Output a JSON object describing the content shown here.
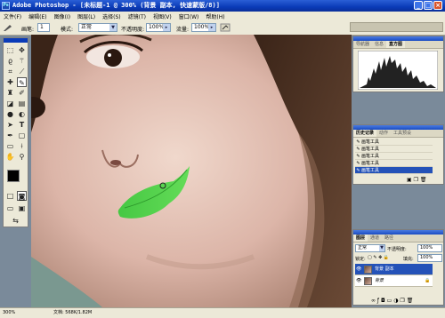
{
  "window": {
    "title": "Adobe Photoshop - [未标题-1 @ 300% (背景 副本, 快速蒙版/8)]",
    "app_icon": "Ps"
  },
  "window_controls": {
    "minimize": "_",
    "maximize": "□",
    "close": "×"
  },
  "menu": [
    "文件(F)",
    "编辑(E)",
    "图像(I)",
    "图层(L)",
    "选择(S)",
    "滤镜(T)",
    "视图(V)",
    "窗口(W)",
    "帮助(H)"
  ],
  "options": {
    "brush_label": "画笔:",
    "brush_size": "1",
    "mode_label": "模式:",
    "mode_value": "正常",
    "opacity_label": "不透明度:",
    "opacity_value": "100%",
    "flow_label": "流量:",
    "flow_value": "100%"
  },
  "navigator": {
    "tabs": [
      "导航器",
      "信息",
      "直方图"
    ],
    "active_tab": "直方图"
  },
  "history": {
    "tabs": [
      "历史记录",
      "动作",
      "工具预设"
    ],
    "items": [
      "画笔工具",
      "画笔工具",
      "画笔工具",
      "画笔工具",
      "画笔工具"
    ],
    "selected_index": 4
  },
  "layers": {
    "tabs": [
      "图层",
      "通道",
      "路径"
    ],
    "mode_value": "正常",
    "opacity_label": "不透明度:",
    "opacity_value": "100%",
    "lock_label": "锁定:",
    "fill_label": "填充:",
    "fill_value": "100%",
    "items": [
      {
        "name": "背景 副本",
        "selected": true
      },
      {
        "name": "背景",
        "selected": false
      }
    ]
  },
  "status": {
    "zoom": "300%",
    "doc": "文档: 568K/1.82M"
  },
  "colors": {
    "foreground": "#000000",
    "background": "#ffffff",
    "quickmask_lips": "#4fd04a",
    "title_bar": "#0a3bb8"
  },
  "icons": {
    "tools": [
      "marquee-icon",
      "move-icon",
      "lasso-icon",
      "magic-wand-icon",
      "crop-icon",
      "slice-icon",
      "healing-icon",
      "brush-icon",
      "stamp-icon",
      "history-brush-icon",
      "eraser-icon",
      "gradient-icon",
      "blur-icon",
      "dodge-icon",
      "path-select-icon",
      "type-icon",
      "pen-icon",
      "shape-icon",
      "notes-icon",
      "eyedropper-icon",
      "hand-icon",
      "zoom-icon"
    ]
  }
}
